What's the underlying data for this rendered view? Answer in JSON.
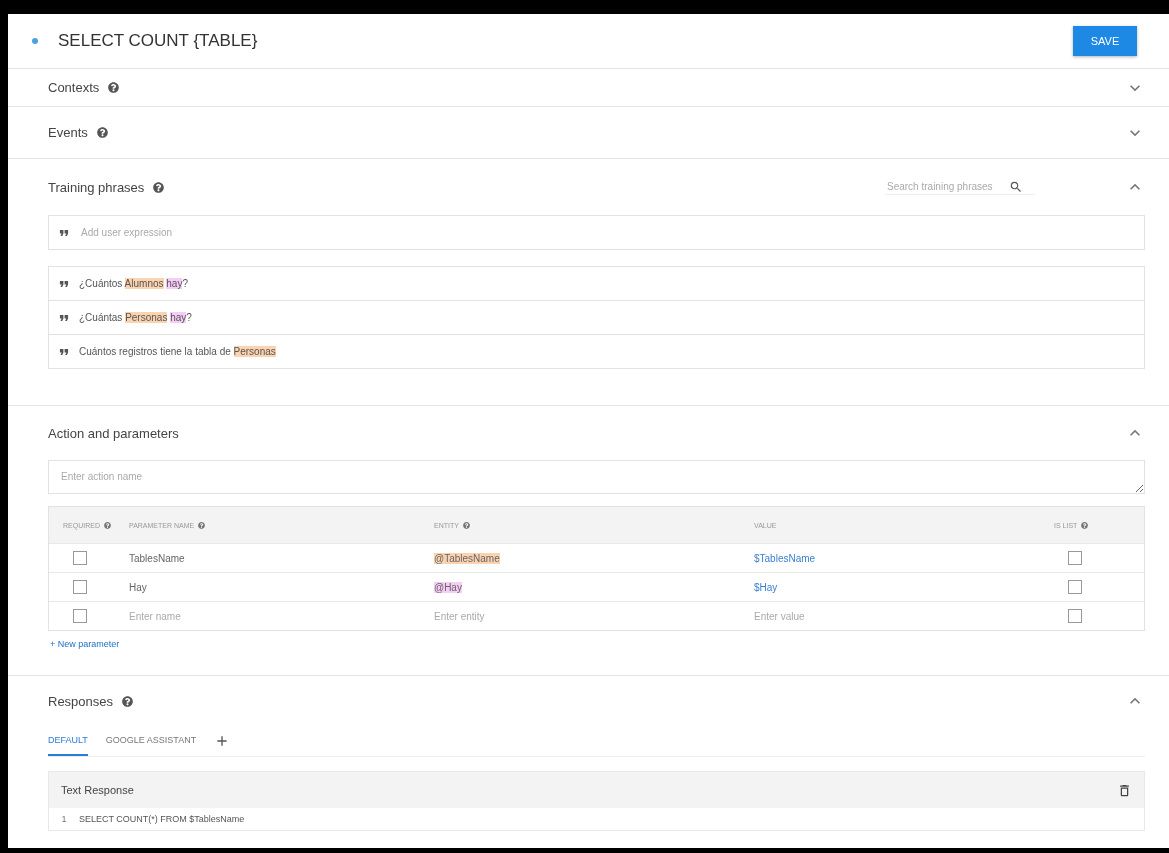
{
  "header": {
    "title": "SELECT COUNT {TABLE}",
    "save": "SAVE"
  },
  "contexts": {
    "title": "Contexts",
    "help": true,
    "expanded": false
  },
  "events": {
    "title": "Events",
    "help": true,
    "expanded": false
  },
  "training_phrases": {
    "title": "Training phrases",
    "help": true,
    "expanded": true,
    "search": {
      "placeholder": "Search training phrases"
    },
    "add": {
      "placeholder": "Add user expression"
    },
    "phrases": [
      {
        "parts": [
          {
            "text": "¿Cuántos "
          },
          {
            "text": "Alumnos",
            "color": "#fcd3b0"
          },
          {
            "text": "hay",
            "color": "#f6cdf6",
            "space_before": true
          },
          {
            "text": "?"
          }
        ]
      },
      {
        "parts": [
          {
            "text": "¿Cuántas "
          },
          {
            "text": "Personas",
            "color": "#fcd3b0"
          },
          {
            "text": "hay",
            "color": "#f6cdf6",
            "space_before": true
          },
          {
            "text": "?"
          }
        ]
      },
      {
        "parts": [
          {
            "text": "Cuántos registros tiene la tabla de "
          },
          {
            "text": "Personas",
            "color": "#fcd3b0"
          }
        ]
      }
    ]
  },
  "action": {
    "title": "Action and parameters",
    "help": false,
    "expanded": true,
    "action_name": {
      "placeholder": "Enter action name"
    },
    "columns": [
      {
        "label": "REQUIRED",
        "help": true
      },
      {
        "label": "PARAMETER NAME",
        "help": true
      },
      {
        "label": "ENTITY",
        "help": true
      },
      {
        "label": "VALUE",
        "help": false
      },
      {
        "label": "IS LIST",
        "help": true
      }
    ],
    "rows": [
      {
        "required": false,
        "name": "TablesName",
        "entity": {
          "text": "@TablesName",
          "color": "#fcd3b0"
        },
        "value": "$TablesName",
        "is_list": false
      },
      {
        "required": false,
        "name": "Hay",
        "entity": {
          "text": "@Hay",
          "color": "#f6cdf6"
        },
        "value": "$Hay",
        "is_list": false
      },
      {
        "required": false,
        "name_placeholder": "Enter name",
        "entity_placeholder": "Enter entity",
        "value_placeholder": "Enter value",
        "is_list": false
      }
    ],
    "new_parameter": "+ New parameter"
  },
  "responses": {
    "title": "Responses",
    "help": true,
    "expanded": true,
    "tabs": [
      {
        "label": "DEFAULT",
        "selected": true
      },
      {
        "label": "GOOGLE ASSISTANT",
        "selected": false
      }
    ],
    "card": {
      "title": "Text Response",
      "lines": [
        {
          "number": "1",
          "text": "SELECT COUNT(*) FROM $TablesName"
        }
      ]
    }
  }
}
